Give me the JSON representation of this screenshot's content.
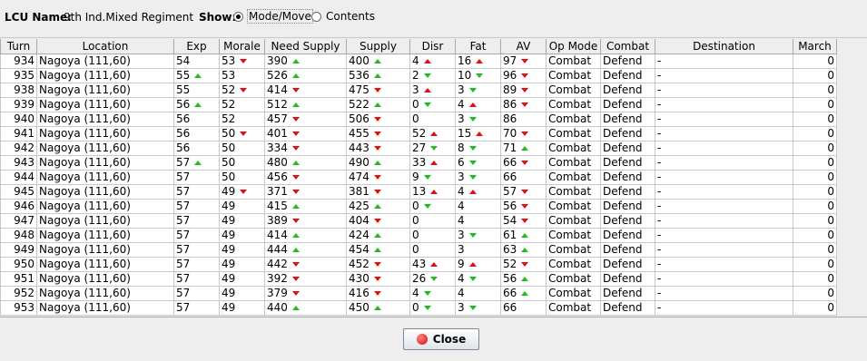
{
  "header": {
    "lcu_label": "LCU Name:",
    "lcu_name": "9th Ind.Mixed Regiment",
    "show_label": "Show:",
    "options": [
      {
        "label": "Mode/Move",
        "selected": true
      },
      {
        "label": "Contents",
        "selected": false
      }
    ]
  },
  "columns": [
    "Turn",
    "Location",
    "Exp",
    "Morale",
    "Need Supply",
    "Supply",
    "Disr",
    "Fat",
    "AV",
    "Op Mode",
    "Combat",
    "Destination",
    "March"
  ],
  "rows": [
    {
      "turn": "934",
      "location": "Nagoya (111,60)",
      "exp": "54",
      "exp_t": "",
      "morale": "53",
      "morale_t": "down",
      "need": "390",
      "need_t": "up",
      "supply": "400",
      "supply_t": "up",
      "disr": "4",
      "disr_t": "upred",
      "fat": "16",
      "fat_t": "upred",
      "av": "97",
      "av_t": "down",
      "opmode": "Combat",
      "combat": "Defend",
      "dest": "-",
      "march": "0"
    },
    {
      "turn": "935",
      "location": "Nagoya (111,60)",
      "exp": "55",
      "exp_t": "up",
      "morale": "53",
      "morale_t": "",
      "need": "526",
      "need_t": "up",
      "supply": "536",
      "supply_t": "up",
      "disr": "2",
      "disr_t": "downgreen",
      "fat": "10",
      "fat_t": "downgreen",
      "av": "96",
      "av_t": "down",
      "opmode": "Combat",
      "combat": "Defend",
      "dest": "-",
      "march": "0"
    },
    {
      "turn": "938",
      "location": "Nagoya (111,60)",
      "exp": "55",
      "exp_t": "",
      "morale": "52",
      "morale_t": "down",
      "need": "414",
      "need_t": "down",
      "supply": "475",
      "supply_t": "down",
      "disr": "3",
      "disr_t": "upred",
      "fat": "3",
      "fat_t": "downgreen",
      "av": "89",
      "av_t": "down",
      "opmode": "Combat",
      "combat": "Defend",
      "dest": "-",
      "march": "0"
    },
    {
      "turn": "939",
      "location": "Nagoya (111,60)",
      "exp": "56",
      "exp_t": "up",
      "morale": "52",
      "morale_t": "",
      "need": "512",
      "need_t": "up",
      "supply": "522",
      "supply_t": "up",
      "disr": "0",
      "disr_t": "downgreen",
      "fat": "4",
      "fat_t": "upred",
      "av": "86",
      "av_t": "down",
      "opmode": "Combat",
      "combat": "Defend",
      "dest": "-",
      "march": "0"
    },
    {
      "turn": "940",
      "location": "Nagoya (111,60)",
      "exp": "56",
      "exp_t": "",
      "morale": "52",
      "morale_t": "",
      "need": "457",
      "need_t": "down",
      "supply": "506",
      "supply_t": "down",
      "disr": "0",
      "disr_t": "",
      "fat": "3",
      "fat_t": "downgreen",
      "av": "86",
      "av_t": "",
      "opmode": "Combat",
      "combat": "Defend",
      "dest": "-",
      "march": "0"
    },
    {
      "turn": "941",
      "location": "Nagoya (111,60)",
      "exp": "56",
      "exp_t": "",
      "morale": "50",
      "morale_t": "down",
      "need": "401",
      "need_t": "down",
      "supply": "455",
      "supply_t": "down",
      "disr": "52",
      "disr_t": "upred",
      "fat": "15",
      "fat_t": "upred",
      "av": "70",
      "av_t": "down",
      "opmode": "Combat",
      "combat": "Defend",
      "dest": "-",
      "march": "0"
    },
    {
      "turn": "942",
      "location": "Nagoya (111,60)",
      "exp": "56",
      "exp_t": "",
      "morale": "50",
      "morale_t": "",
      "need": "334",
      "need_t": "down",
      "supply": "443",
      "supply_t": "down",
      "disr": "27",
      "disr_t": "downgreen",
      "fat": "8",
      "fat_t": "downgreen",
      "av": "71",
      "av_t": "up",
      "opmode": "Combat",
      "combat": "Defend",
      "dest": "-",
      "march": "0"
    },
    {
      "turn": "943",
      "location": "Nagoya (111,60)",
      "exp": "57",
      "exp_t": "up",
      "morale": "50",
      "morale_t": "",
      "need": "480",
      "need_t": "up",
      "supply": "490",
      "supply_t": "up",
      "disr": "33",
      "disr_t": "upred",
      "fat": "6",
      "fat_t": "downgreen",
      "av": "66",
      "av_t": "down",
      "opmode": "Combat",
      "combat": "Defend",
      "dest": "-",
      "march": "0"
    },
    {
      "turn": "944",
      "location": "Nagoya (111,60)",
      "exp": "57",
      "exp_t": "",
      "morale": "50",
      "morale_t": "",
      "need": "456",
      "need_t": "down",
      "supply": "474",
      "supply_t": "down",
      "disr": "9",
      "disr_t": "downgreen",
      "fat": "3",
      "fat_t": "downgreen",
      "av": "66",
      "av_t": "",
      "opmode": "Combat",
      "combat": "Defend",
      "dest": "-",
      "march": "0"
    },
    {
      "turn": "945",
      "location": "Nagoya (111,60)",
      "exp": "57",
      "exp_t": "",
      "morale": "49",
      "morale_t": "down",
      "need": "371",
      "need_t": "down",
      "supply": "381",
      "supply_t": "down",
      "disr": "13",
      "disr_t": "upred",
      "fat": "4",
      "fat_t": "upred",
      "av": "57",
      "av_t": "down",
      "opmode": "Combat",
      "combat": "Defend",
      "dest": "-",
      "march": "0"
    },
    {
      "turn": "946",
      "location": "Nagoya (111,60)",
      "exp": "57",
      "exp_t": "",
      "morale": "49",
      "morale_t": "",
      "need": "415",
      "need_t": "up",
      "supply": "425",
      "supply_t": "up",
      "disr": "0",
      "disr_t": "downgreen",
      "fat": "4",
      "fat_t": "",
      "av": "56",
      "av_t": "down",
      "opmode": "Combat",
      "combat": "Defend",
      "dest": "-",
      "march": "0"
    },
    {
      "turn": "947",
      "location": "Nagoya (111,60)",
      "exp": "57",
      "exp_t": "",
      "morale": "49",
      "morale_t": "",
      "need": "389",
      "need_t": "down",
      "supply": "404",
      "supply_t": "down",
      "disr": "0",
      "disr_t": "",
      "fat": "4",
      "fat_t": "",
      "av": "54",
      "av_t": "down",
      "opmode": "Combat",
      "combat": "Defend",
      "dest": "-",
      "march": "0"
    },
    {
      "turn": "948",
      "location": "Nagoya (111,60)",
      "exp": "57",
      "exp_t": "",
      "morale": "49",
      "morale_t": "",
      "need": "414",
      "need_t": "up",
      "supply": "424",
      "supply_t": "up",
      "disr": "0",
      "disr_t": "",
      "fat": "3",
      "fat_t": "downgreen",
      "av": "61",
      "av_t": "up",
      "opmode": "Combat",
      "combat": "Defend",
      "dest": "-",
      "march": "0"
    },
    {
      "turn": "949",
      "location": "Nagoya (111,60)",
      "exp": "57",
      "exp_t": "",
      "morale": "49",
      "morale_t": "",
      "need": "444",
      "need_t": "up",
      "supply": "454",
      "supply_t": "up",
      "disr": "0",
      "disr_t": "",
      "fat": "3",
      "fat_t": "",
      "av": "63",
      "av_t": "up",
      "opmode": "Combat",
      "combat": "Defend",
      "dest": "-",
      "march": "0"
    },
    {
      "turn": "950",
      "location": "Nagoya (111,60)",
      "exp": "57",
      "exp_t": "",
      "morale": "49",
      "morale_t": "",
      "need": "442",
      "need_t": "down",
      "supply": "452",
      "supply_t": "down",
      "disr": "43",
      "disr_t": "upred",
      "fat": "9",
      "fat_t": "upred",
      "av": "52",
      "av_t": "down",
      "opmode": "Combat",
      "combat": "Defend",
      "dest": "-",
      "march": "0"
    },
    {
      "turn": "951",
      "location": "Nagoya (111,60)",
      "exp": "57",
      "exp_t": "",
      "morale": "49",
      "morale_t": "",
      "need": "392",
      "need_t": "down",
      "supply": "430",
      "supply_t": "down",
      "disr": "26",
      "disr_t": "downgreen",
      "fat": "4",
      "fat_t": "downgreen",
      "av": "56",
      "av_t": "up",
      "opmode": "Combat",
      "combat": "Defend",
      "dest": "-",
      "march": "0"
    },
    {
      "turn": "952",
      "location": "Nagoya (111,60)",
      "exp": "57",
      "exp_t": "",
      "morale": "49",
      "morale_t": "",
      "need": "379",
      "need_t": "down",
      "supply": "416",
      "supply_t": "down",
      "disr": "4",
      "disr_t": "downgreen",
      "fat": "4",
      "fat_t": "",
      "av": "66",
      "av_t": "up",
      "opmode": "Combat",
      "combat": "Defend",
      "dest": "-",
      "march": "0"
    },
    {
      "turn": "953",
      "location": "Nagoya (111,60)",
      "exp": "57",
      "exp_t": "",
      "morale": "49",
      "morale_t": "",
      "need": "440",
      "need_t": "up",
      "supply": "450",
      "supply_t": "up",
      "disr": "0",
      "disr_t": "downgreen",
      "fat": "3",
      "fat_t": "downgreen",
      "av": "66",
      "av_t": "",
      "opmode": "Combat",
      "combat": "Defend",
      "dest": "-",
      "march": "0"
    }
  ],
  "footer": {
    "close_label": "Close",
    "close_icon": "red-circle-icon"
  }
}
